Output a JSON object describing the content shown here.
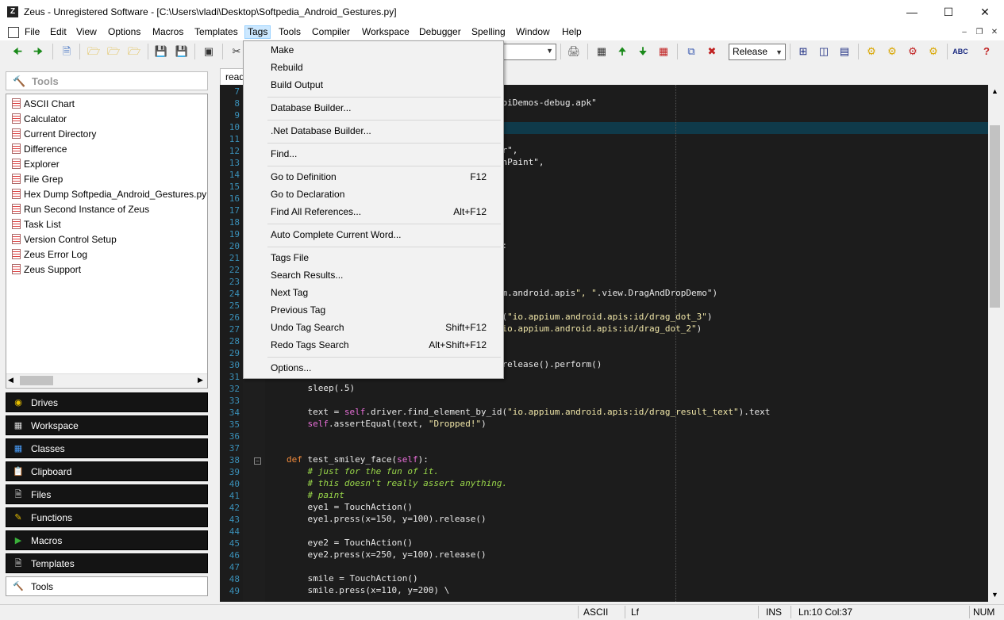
{
  "window": {
    "title": "Zeus - Unregistered Software - [C:\\Users\\vladi\\Desktop\\Softpedia_Android_Gestures.py]",
    "app_icon": "Z"
  },
  "menubar": [
    "File",
    "Edit",
    "View",
    "Options",
    "Macros",
    "Templates",
    "Tags",
    "Tools",
    "Compiler",
    "Workspace",
    "Debugger",
    "Spelling",
    "Window",
    "Help"
  ],
  "toolbar": {
    "build_config": "Release"
  },
  "tools_panel": {
    "header": "Tools",
    "items": [
      "ASCII Chart",
      "Calculator",
      "Current Directory",
      "Difference",
      "Explorer",
      "File Grep",
      "Hex Dump  Softpedia_Android_Gestures.py",
      "Run Second Instance of Zeus",
      "Task List",
      "Version Control Setup",
      "Zeus Error Log",
      "Zeus Support"
    ]
  },
  "panels": [
    "Drives",
    "Workspace",
    "Classes",
    "Clipboard",
    "Files",
    "Functions",
    "Macros",
    "Templates",
    "Tools"
  ],
  "editor": {
    "tab": "readme",
    "lines": [
      {
        "n": "7",
        "t": ""
      },
      {
        "n": "8",
        "t": "                                      s/ApiDemos-debug.apk\""
      },
      {
        "n": "9",
        "t": ""
      },
      {
        "n": "10",
        "t": ""
      },
      {
        "n": "11",
        "t": ""
      },
      {
        "n": "12",
        "t": "                                      ator\","
      },
      {
        "n": "13",
        "t": "                                      ouchPaint\","
      },
      {
        "n": "14",
        "t": ""
      },
      {
        "n": "15",
        "t": ""
      },
      {
        "n": "16",
        "t": ""
      },
      {
        "n": "17",
        "t": ""
      },
      {
        "n": "18",
        "t": ""
      },
      {
        "n": "19",
        "t": ""
      },
      {
        "n": "20",
        "t": "                                      se):"
      },
      {
        "n": "21",
        "t": ""
      },
      {
        "n": "22",
        "t": ""
      },
      {
        "n": "23",
        "t": ""
      },
      {
        "n": "24",
        "t": "                                      pium.android.apis\", \".view.DragAndDropDemo\")"
      },
      {
        "n": "25",
        "t": ""
      },
      {
        "n": "26",
        "t": "                                      _id(\"io.appium.android.apis:id/drag_dot_3\")"
      },
      {
        "n": "27",
        "t": "                                      d(\"io.appium.android.apis:id/drag_dot_2\")"
      },
      {
        "n": "28",
        "t": ""
      },
      {
        "n": "29",
        "t": ""
      },
      {
        "n": "30",
        "t": "                                      d).release().perform()"
      },
      {
        "n": "31",
        "t": ""
      },
      {
        "n": "32",
        "t": "    sleep(.5)"
      },
      {
        "n": "33",
        "t": ""
      },
      {
        "n": "34",
        "t": "    text = self.driver.find_element_by_id(\"io.appium.android.apis:id/drag_result_text\").text"
      },
      {
        "n": "35",
        "t": "    self.assertEqual(text, \"Dropped!\")"
      },
      {
        "n": "36",
        "t": ""
      },
      {
        "n": "37",
        "t": ""
      },
      {
        "n": "38",
        "t": "def test_smiley_face(self):"
      },
      {
        "n": "39",
        "t": "    # just for the fun of it."
      },
      {
        "n": "40",
        "t": "    # this doesn't really assert anything."
      },
      {
        "n": "41",
        "t": "    # paint"
      },
      {
        "n": "42",
        "t": "    eye1 = TouchAction()"
      },
      {
        "n": "43",
        "t": "    eye1.press(x=150, y=100).release()"
      },
      {
        "n": "44",
        "t": ""
      },
      {
        "n": "45",
        "t": "    eye2 = TouchAction()"
      },
      {
        "n": "46",
        "t": "    eye2.press(x=250, y=100).release()"
      },
      {
        "n": "47",
        "t": ""
      },
      {
        "n": "48",
        "t": "    smile = TouchAction()"
      },
      {
        "n": "49",
        "t": "    smile.press(x=110, y=200) \\"
      }
    ]
  },
  "tags_menu": {
    "items": [
      {
        "label": "Make",
        "key": ""
      },
      {
        "label": "Rebuild",
        "key": ""
      },
      {
        "label": "Build Output",
        "key": ""
      },
      {
        "label": "Database Builder...",
        "key": ""
      },
      {
        "label": ".Net Database Builder...",
        "key": ""
      },
      {
        "label": "Find...",
        "key": ""
      },
      {
        "label": "Go to Definition",
        "key": "F12"
      },
      {
        "label": "Go to Declaration",
        "key": ""
      },
      {
        "label": "Find All References...",
        "key": "Alt+F12"
      },
      {
        "label": "Auto Complete Current Word...",
        "key": ""
      },
      {
        "label": "Tags File",
        "key": ""
      },
      {
        "label": "Search Results...",
        "key": ""
      },
      {
        "label": "Next Tag",
        "key": ""
      },
      {
        "label": "Previous Tag",
        "key": ""
      },
      {
        "label": "Undo Tag Search",
        "key": "Shift+F12"
      },
      {
        "label": "Redo Tags Search",
        "key": "Alt+Shift+F12"
      },
      {
        "label": "Options...",
        "key": ""
      }
    ]
  },
  "statusbar": {
    "encoding": "ASCII",
    "eol": "Lf",
    "mode": "INS",
    "position": "Ln:10 Col:37",
    "numlock": "NUM"
  },
  "colors": {
    "editor_bg": "#1c1c1c",
    "line_numbers": "#3a8fb7",
    "keyword": "#f08a3c",
    "string": "#f0e6a8",
    "comment": "#9ad84a",
    "self": "#e96fd9"
  }
}
